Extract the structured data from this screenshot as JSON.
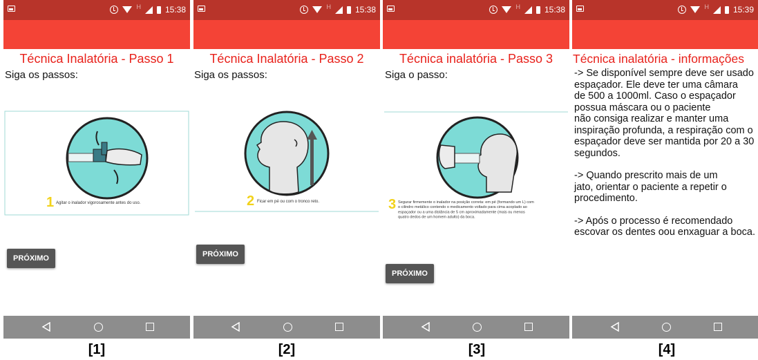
{
  "screens": [
    {
      "label": "[1]",
      "status_time": "15:38",
      "title": "Técnica Inalatória - Passo 1",
      "subtitle": "Siga os passos:",
      "step_number": "1",
      "step_text": "Agitar o inalador vigorosamente antes do uso.",
      "button": "PRÓXIMO"
    },
    {
      "label": "[2]",
      "status_time": "15:38",
      "title": "Técnica Inalatória - Passo 2",
      "subtitle": "Siga os passos:",
      "step_number": "2",
      "step_text": "Ficar em pé ou com o tronco reto.",
      "button": "PRÓXIMO"
    },
    {
      "label": "[3]",
      "status_time": "15:38",
      "title": "Técnica inalatória - Passo 3",
      "subtitle": "Siga o passo:",
      "step_number": "3",
      "step_text_lines": [
        "Segurar firmemente o inalador na posição correta: em pé (formando um L) com",
        "o cilindro metálico contendo o medicamento voltado para cima acoplado ao",
        "espaçador ou a uma distância de 5 cm aproximadamente (mais ou menos",
        "quatro dedos de um homem adulto) da boca."
      ],
      "button": "PRÓXIMO"
    },
    {
      "label": "[4]",
      "status_time": "15:39",
      "title": "Técnica inalatória - informações",
      "paragraphs": [
        [
          "-> Se disponível sempre deve ser usado",
          "espaçador. Ele deve ter uma câmara",
          "de 500 a 1000ml. Caso o espaçador",
          "possua máscara ou o paciente",
          "não consiga realizar e manter uma",
          "inspiração profunda, a respiração com o",
          "espaçador deve ser mantida por 20 a 30",
          "segundos."
        ],
        [
          "-> Quando prescrito mais de um",
          "jato, orientar o paciente a repetir o",
          "procedimento."
        ],
        [
          "-> Após o processo é recomendado",
          "escovar os dentes oou enxaguar a boca."
        ]
      ]
    }
  ],
  "icons": {
    "status_left": "image-notification-icon",
    "alarm": "alarm-icon",
    "wifi": "wifi-icon",
    "signal": "signal-icon",
    "battery": "battery-icon",
    "nav_back": "back-icon",
    "nav_home": "home-icon",
    "nav_recent": "recent-apps-icon"
  },
  "colors": {
    "status_bar": "#b8342a",
    "app_bar": "#f44336",
    "title": "#e8211b",
    "button": "#555555",
    "nav_bar": "#8d8d8d",
    "illustration_circle": "#7ddbd6",
    "step_number": "#f2d21b"
  }
}
